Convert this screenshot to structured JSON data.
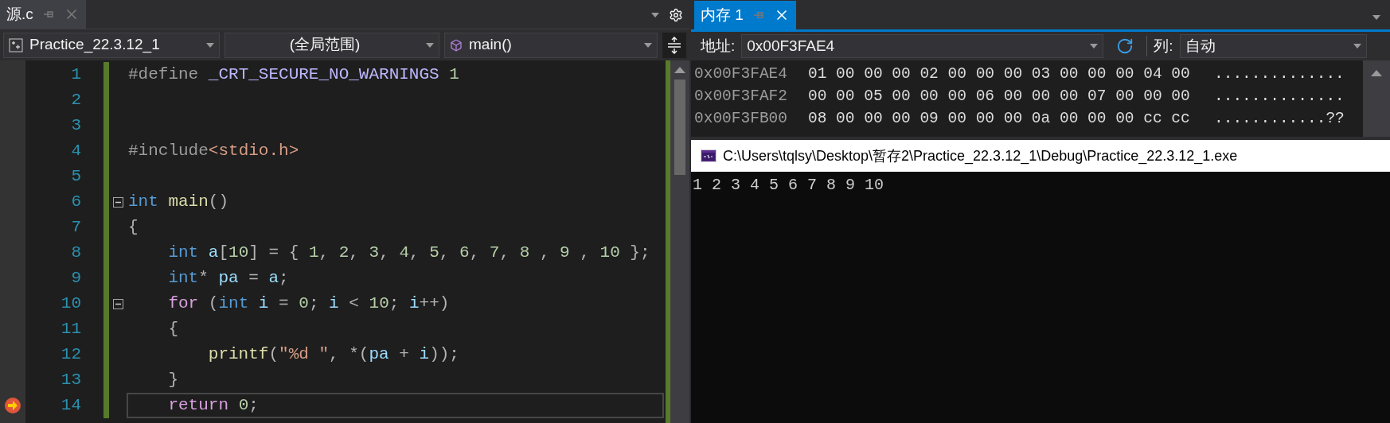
{
  "editor": {
    "tab": {
      "title": "源.c",
      "selected": true
    },
    "nav": {
      "project": "Practice_22.3.12_1",
      "scope": "(全局范围)",
      "member": "main()"
    },
    "lines": [
      {
        "number": "1",
        "fold": false,
        "current": false,
        "tokens": [
          {
            "kind": "preproc",
            "text": "#define "
          },
          {
            "kind": "macro",
            "text": "_CRT_SECURE_NO_WARNINGS"
          },
          {
            "kind": "number",
            "text": " 1"
          }
        ]
      },
      {
        "number": "2",
        "fold": false,
        "current": false
      },
      {
        "number": "3",
        "fold": false,
        "current": false
      },
      {
        "number": "4",
        "fold": false,
        "current": false,
        "tokens": [
          {
            "kind": "preproc",
            "text": "#include"
          },
          {
            "kind": "header",
            "text": "<stdio.h>"
          }
        ]
      },
      {
        "number": "5",
        "fold": false,
        "current": false
      },
      {
        "number": "6",
        "fold": true,
        "current": false,
        "tokens": [
          {
            "kind": "type",
            "text": "int"
          },
          {
            "kind": "func",
            "text": " main"
          },
          {
            "kind": "punct",
            "text": "()"
          }
        ]
      },
      {
        "number": "7",
        "fold": false,
        "current": false,
        "tokens": [
          {
            "kind": "punct",
            "text": "{"
          }
        ]
      },
      {
        "number": "8",
        "fold": false,
        "current": false,
        "tokens": [
          {
            "kind": "type",
            "text": "    int"
          },
          {
            "kind": "var",
            "text": " a"
          },
          {
            "kind": "punct",
            "text": "["
          },
          {
            "kind": "number",
            "text": "10"
          },
          {
            "kind": "punct",
            "text": "] = { "
          },
          {
            "kind": "number",
            "text": "1"
          },
          {
            "kind": "punct",
            "text": ", "
          },
          {
            "kind": "number",
            "text": "2"
          },
          {
            "kind": "punct",
            "text": ", "
          },
          {
            "kind": "number",
            "text": "3"
          },
          {
            "kind": "punct",
            "text": ", "
          },
          {
            "kind": "number",
            "text": "4"
          },
          {
            "kind": "punct",
            "text": ", "
          },
          {
            "kind": "number",
            "text": "5"
          },
          {
            "kind": "punct",
            "text": ", "
          },
          {
            "kind": "number",
            "text": "6"
          },
          {
            "kind": "punct",
            "text": ", "
          },
          {
            "kind": "number",
            "text": "7"
          },
          {
            "kind": "punct",
            "text": ", "
          },
          {
            "kind": "number",
            "text": "8"
          },
          {
            "kind": "punct",
            "text": " , "
          },
          {
            "kind": "number",
            "text": "9"
          },
          {
            "kind": "punct",
            "text": " , "
          },
          {
            "kind": "number",
            "text": "10"
          },
          {
            "kind": "punct",
            "text": " };"
          }
        ]
      },
      {
        "number": "9",
        "fold": false,
        "current": false,
        "tokens": [
          {
            "kind": "type",
            "text": "    int"
          },
          {
            "kind": "punct",
            "text": "* "
          },
          {
            "kind": "var",
            "text": "pa"
          },
          {
            "kind": "punct",
            "text": " = "
          },
          {
            "kind": "var",
            "text": "a"
          },
          {
            "kind": "punct",
            "text": ";"
          }
        ]
      },
      {
        "number": "10",
        "fold": true,
        "current": false,
        "tokens": [
          {
            "kind": "keyword",
            "text": "    for"
          },
          {
            "kind": "punct",
            "text": " ("
          },
          {
            "kind": "type",
            "text": "int"
          },
          {
            "kind": "var",
            "text": " i"
          },
          {
            "kind": "punct",
            "text": " = "
          },
          {
            "kind": "number",
            "text": "0"
          },
          {
            "kind": "punct",
            "text": "; "
          },
          {
            "kind": "var",
            "text": "i"
          },
          {
            "kind": "punct",
            "text": " < "
          },
          {
            "kind": "number",
            "text": "10"
          },
          {
            "kind": "punct",
            "text": "; "
          },
          {
            "kind": "var",
            "text": "i"
          },
          {
            "kind": "punct",
            "text": "++)"
          }
        ]
      },
      {
        "number": "11",
        "fold": false,
        "current": false,
        "tokens": [
          {
            "kind": "punct",
            "text": "    {"
          }
        ]
      },
      {
        "number": "12",
        "fold": false,
        "current": false,
        "tokens": [
          {
            "kind": "func",
            "text": "        printf"
          },
          {
            "kind": "punct",
            "text": "("
          },
          {
            "kind": "string",
            "text": "\"%d \""
          },
          {
            "kind": "punct",
            "text": ", *("
          },
          {
            "kind": "var",
            "text": "pa"
          },
          {
            "kind": "punct",
            "text": " + "
          },
          {
            "kind": "var",
            "text": "i"
          },
          {
            "kind": "punct",
            "text": "));"
          }
        ]
      },
      {
        "number": "13",
        "fold": false,
        "current": false,
        "tokens": [
          {
            "kind": "punct",
            "text": "    }"
          }
        ]
      },
      {
        "number": "14",
        "fold": false,
        "current": true,
        "tokens": [
          {
            "kind": "keyword",
            "text": "    return"
          },
          {
            "kind": "number",
            "text": " 0"
          },
          {
            "kind": "punct",
            "text": ";"
          }
        ]
      }
    ]
  },
  "memory": {
    "tab": {
      "title": "内存 1",
      "selected": true
    },
    "address_label": "地址:",
    "address": "0x00F3FAE4",
    "columns_label": "列:",
    "columns": "自动",
    "rows": [
      {
        "address": "0x00F3FAE4",
        "bytes": "01 00 00 00 02 00 00 00 03 00 00 00 04 00",
        "ascii": ".............."
      },
      {
        "address": "0x00F3FAF2",
        "bytes": "00 00 05 00 00 00 06 00 00 00 07 00 00 00",
        "ascii": ".............."
      },
      {
        "address": "0x00F3FB00",
        "bytes": "08 00 00 00 09 00 00 00 0a 00 00 00 cc cc",
        "ascii": "............??"
      }
    ]
  },
  "console": {
    "title": "C:\\Users\\tqlsy\\Desktop\\暂存2\\Practice_22.3.12_1\\Debug\\Practice_22.3.12_1.exe",
    "output": "1 2 3 4 5 6 7 8 9 10"
  }
}
